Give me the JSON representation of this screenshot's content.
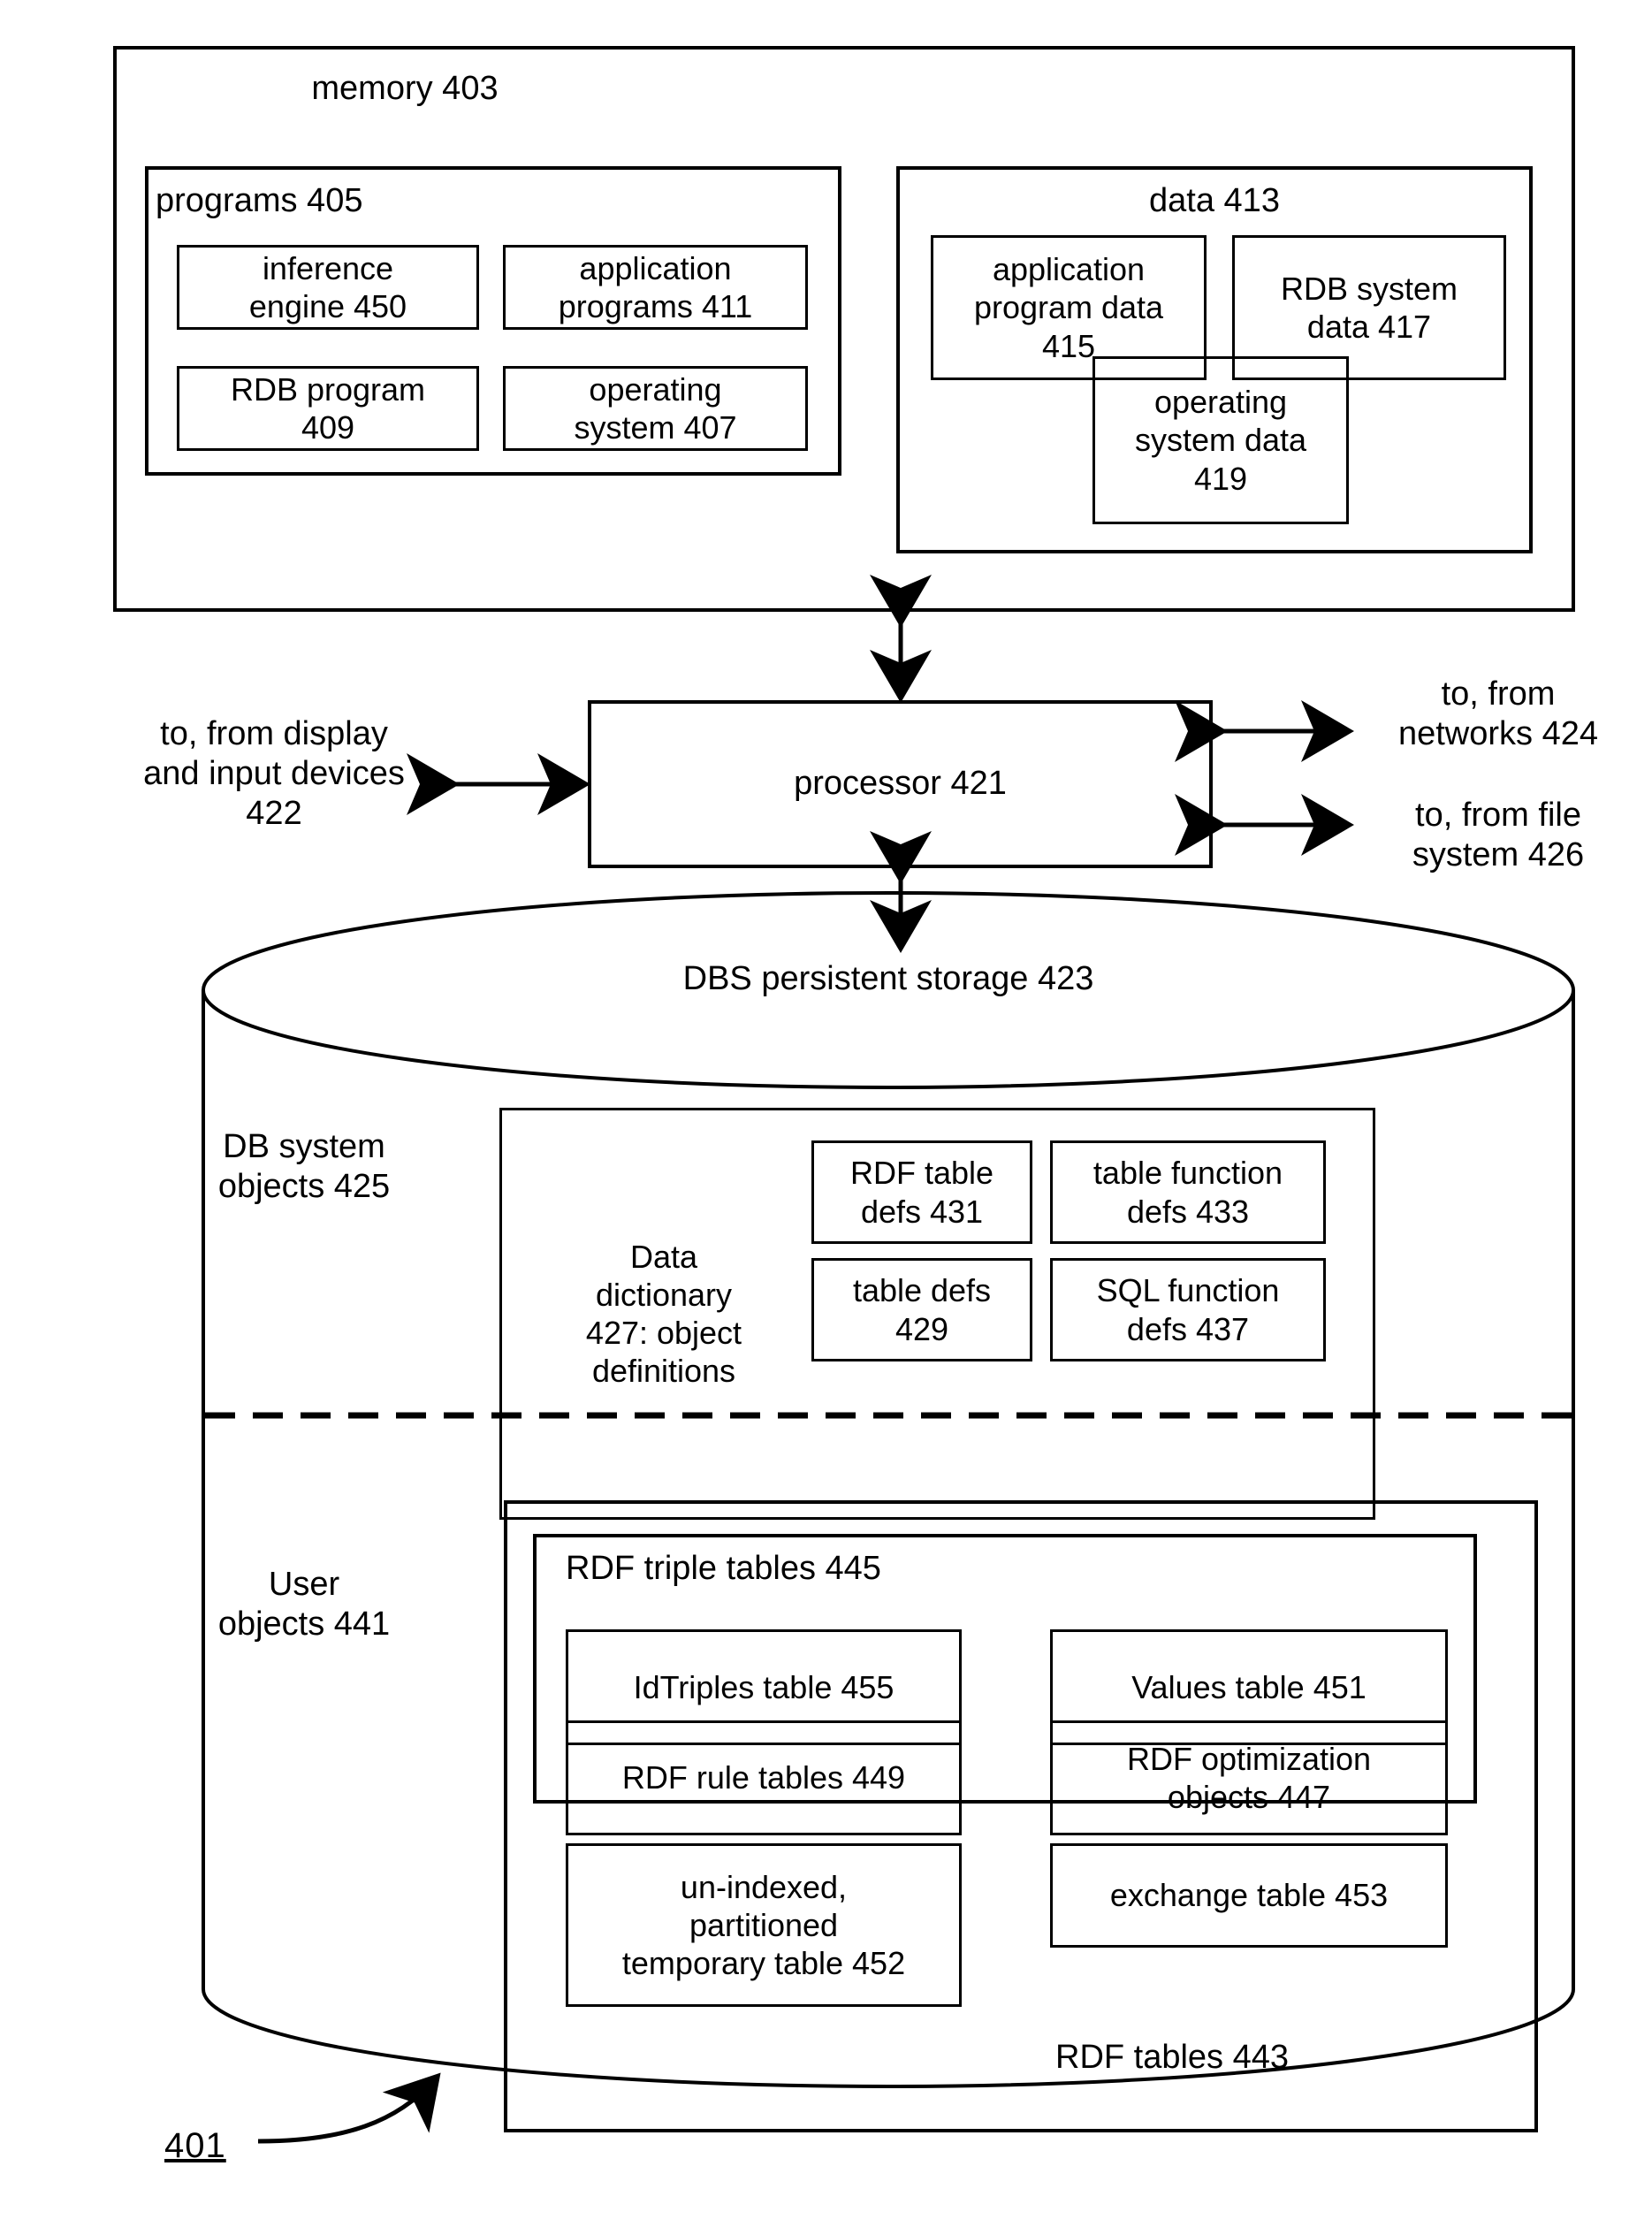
{
  "figure": {
    "number": "401"
  },
  "memory": {
    "title": "memory 403",
    "programs": {
      "title": "programs 405",
      "boxes": [
        {
          "label": "inference\nengine 450"
        },
        {
          "label": "application\nprograms 411"
        },
        {
          "label": "RDB program\n409"
        },
        {
          "label": "operating\nsystem 407"
        }
      ]
    },
    "data": {
      "title": "data 413",
      "boxes": [
        {
          "label": "application\nprogram data\n415"
        },
        {
          "label": "RDB system\ndata 417"
        },
        {
          "label": "operating\nsystem data\n419"
        }
      ]
    }
  },
  "processor": {
    "label": "processor 421",
    "left_io": "to, from display\nand input devices\n422",
    "right_io_top": "to, from\nnetworks 424",
    "right_io_bottom": "to, from file\nsystem 426"
  },
  "storage": {
    "title": "DBS persistent storage 423",
    "db_system_objects": {
      "label": "DB system\nobjects 425",
      "data_dictionary": {
        "label": "Data\ndictionary\n427: object\ndefinitions",
        "boxes": [
          {
            "label": "RDF table\ndefs 431"
          },
          {
            "label": "table function\ndefs 433"
          },
          {
            "label": "table defs\n429"
          },
          {
            "label": "SQL function\ndefs 437"
          }
        ]
      }
    },
    "user_objects": {
      "label": "User\nobjects 441",
      "rdf_tables": {
        "label": "RDF tables 443",
        "triple_tables": {
          "label": "RDF triple tables 445",
          "boxes": [
            {
              "label": "IdTriples table 455"
            },
            {
              "label": "Values table 451"
            }
          ]
        },
        "boxes": [
          {
            "label": "RDF rule tables 449"
          },
          {
            "label": "RDF optimization\nobjects 447"
          },
          {
            "label": "un-indexed,\npartitioned\ntemporary table 452"
          },
          {
            "label": "exchange table 453"
          }
        ]
      }
    }
  }
}
